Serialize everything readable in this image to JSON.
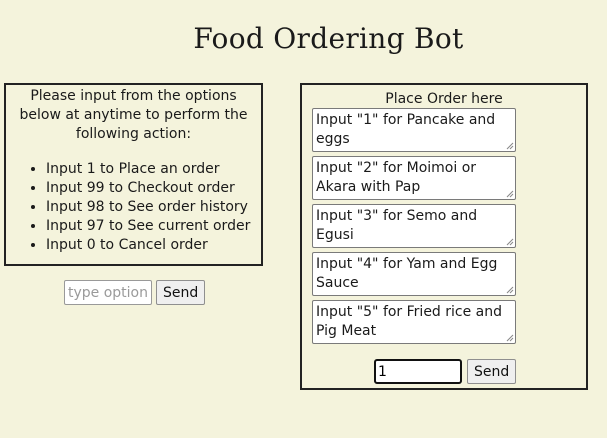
{
  "title": "Food Ordering Bot",
  "instructions": {
    "intro": "Please input from the options below at anytime to perform the following action:",
    "items": [
      "Input 1 to Place an order",
      "Input 99 to Checkout order",
      "Input 98 to See order history",
      "Input 97 to See current order",
      "Input 0 to Cancel order"
    ]
  },
  "option_form": {
    "placeholder": "type option",
    "send_label": "Send"
  },
  "order_panel": {
    "title": "Place Order here",
    "menu_items": [
      "Input \"1\" for Pancake and eggs",
      "Input \"2\" for Moimoi or Akara with Pap",
      "Input \"3\" for Semo and Egusi",
      "Input \"4\" for Yam and Egg Sauce",
      "Input \"5\" for Fried rice and Pig Meat"
    ],
    "input_value": "1",
    "send_label": "Send"
  }
}
